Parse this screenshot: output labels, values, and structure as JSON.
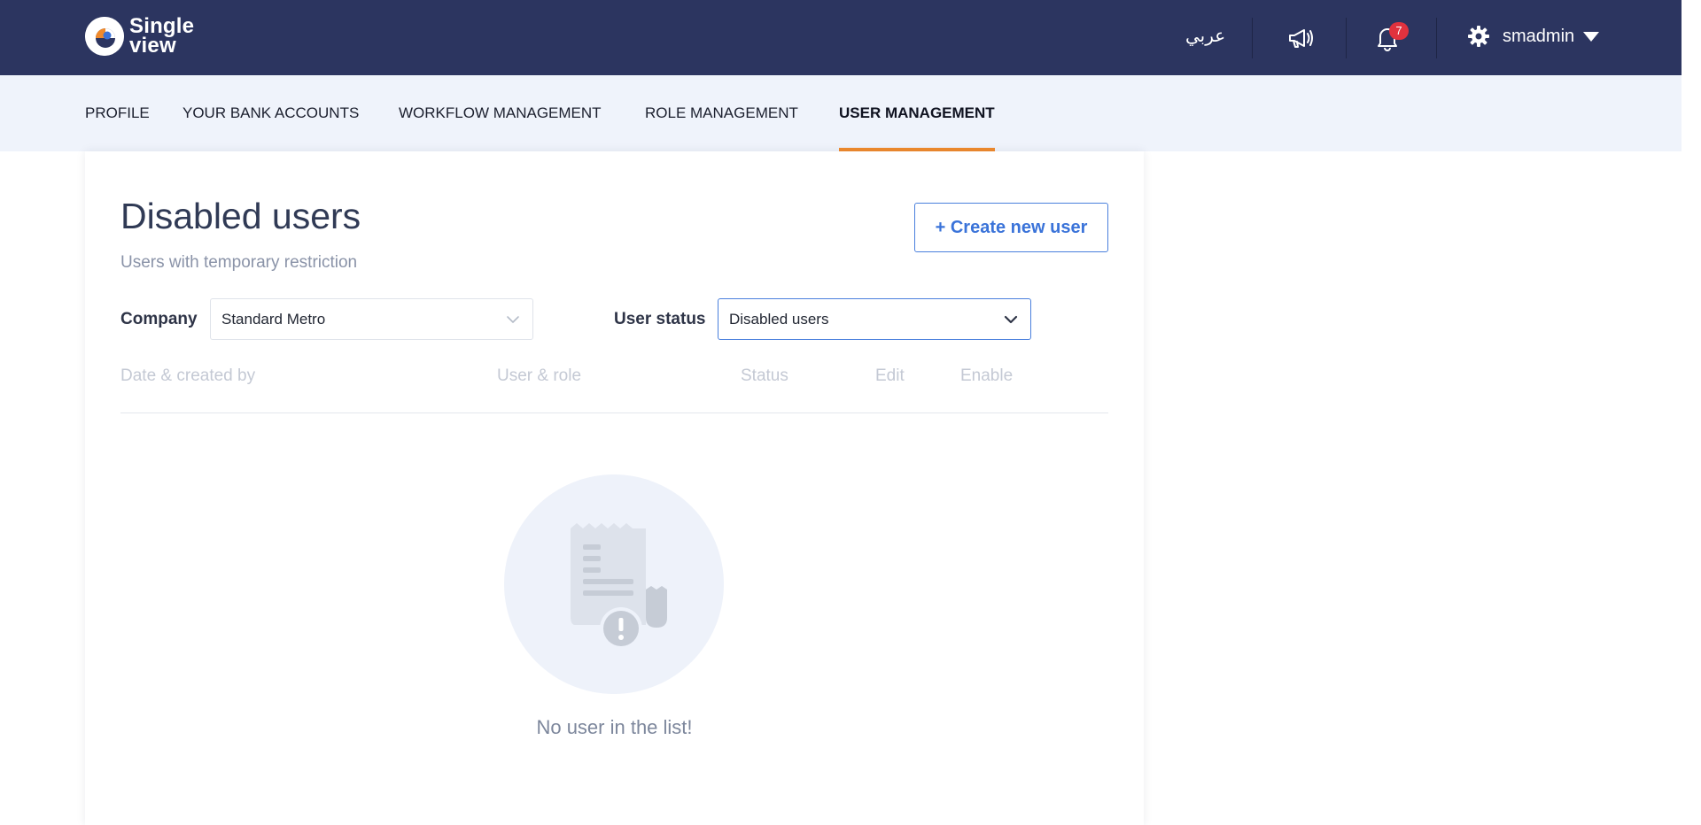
{
  "app": {
    "logo_line1": "Single",
    "logo_line2": "view"
  },
  "topbar": {
    "language_label": "عربي",
    "notification_count": "7",
    "username": "smadmin"
  },
  "tabs": [
    {
      "label": "PROFILE",
      "active": false
    },
    {
      "label": "YOUR BANK ACCOUNTS",
      "active": false
    },
    {
      "label": "WORKFLOW MANAGEMENT",
      "active": false
    },
    {
      "label": "ROLE MANAGEMENT",
      "active": false
    },
    {
      "label": "USER MANAGEMENT",
      "active": true
    }
  ],
  "main": {
    "title": "Disabled users",
    "subtitle": "Users with temporary restriction",
    "create_button": "+ Create new user",
    "company_label": "Company",
    "company_value": "Standard Metro",
    "status_label": "User status",
    "status_value": "Disabled users",
    "columns": [
      "Date & created by",
      "User & role",
      "Status",
      "Edit",
      "Enable"
    ],
    "empty_message": "No user in the list!"
  },
  "colors": {
    "navbar": "#2c3560",
    "accent_orange": "#f08a2c",
    "primary_blue": "#3a73d9",
    "badge_red": "#e0323e"
  }
}
